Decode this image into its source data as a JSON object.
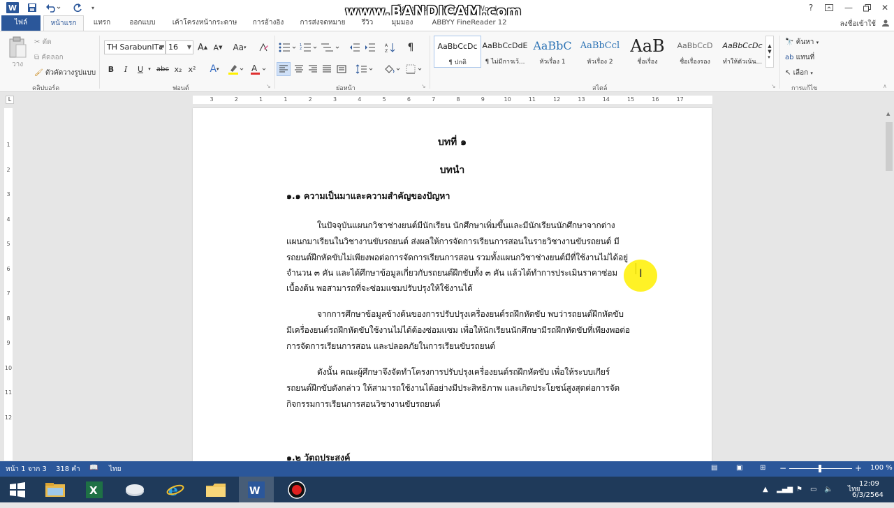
{
  "titlebar": {
    "title": "โครงการ1 - Microsoft Word",
    "watermark": "www.BANDICAM.com",
    "help": "?",
    "icons": [
      "save-icon",
      "undo-icon",
      "redo-icon",
      "customize-icon"
    ]
  },
  "tabs": [
    {
      "label": "ไฟล์"
    },
    {
      "label": "หน้าแรก"
    },
    {
      "label": "แทรก"
    },
    {
      "label": "ออกแบบ"
    },
    {
      "label": "เค้าโครงหน้ากระดาษ"
    },
    {
      "label": "การอ้างอิง"
    },
    {
      "label": "การส่งจดหมาย"
    },
    {
      "label": "รีวิว"
    },
    {
      "label": "มุมมอง"
    },
    {
      "label": "ABBYY FineReader 12"
    }
  ],
  "signin": "ลงชื่อเข้าใช้",
  "ribbon": {
    "clipboard": {
      "paste": "วาง",
      "cut": "ตัด",
      "copy": "คัดลอก",
      "format_painter": "ตัวคัดวางรูปแบบ",
      "label": "คลิปบอร์ด"
    },
    "font": {
      "name": "TH SarabunIT๙",
      "size": "16",
      "label": "ฟอนต์",
      "bold": "B",
      "italic": "I",
      "underline": "U",
      "strike": "abc",
      "sub": "x₂",
      "sup": "x²",
      "case": "Aa"
    },
    "paragraph": {
      "label": "ย่อหน้า"
    },
    "styles": {
      "label": "สไตล์",
      "items": [
        {
          "preview": "AaBbCcDc",
          "name": "¶ ปกติ"
        },
        {
          "preview": "AaBbCcDdE",
          "name": "¶ ไม่มีการเว้..."
        },
        {
          "preview": "AaBbC",
          "name": "หัวเรื่อง 1"
        },
        {
          "preview": "AaBbCcl",
          "name": "หัวเรื่อง 2"
        },
        {
          "preview": "AaB",
          "name": "ชื่อเรื่อง"
        },
        {
          "preview": "AaBbCcD",
          "name": "ชื่อเรื่องรอง"
        },
        {
          "preview": "AaBbCcDc",
          "name": "ทำให้ตัวเน้น..."
        }
      ]
    },
    "editing": {
      "label": "การแก้ไข",
      "find": "ค้นหา",
      "replace": "แทนที่",
      "select": "เลือก"
    }
  },
  "ruler": {
    "numbers": [
      "3",
      "2",
      "1",
      "1",
      "2",
      "3",
      "4",
      "5",
      "6",
      "7",
      "8",
      "9",
      "10",
      "11",
      "12",
      "13",
      "14",
      "15",
      "16",
      "17"
    ],
    "vnumbers": [
      "1",
      "2",
      "3",
      "4",
      "5",
      "6",
      "7",
      "8",
      "9",
      "10",
      "11",
      "12"
    ]
  },
  "document": {
    "chapter": "บทที่ ๑",
    "chapter_title": "บทนำ",
    "section1": "๑.๑ ความเป็นมาและความสำคัญของปัญหา",
    "para1": [
      "ในปัจจุบันแผนกวิชาช่างยนต์มีนักเรียน นักศึกษาเพิ่มขึ้นและมีนักเรียนนักศึกษาจากต่าง",
      "แผนกมาเรียนในวิชางานขับรถยนต์ ส่งผลให้การจัดการเรียนการสอนในรายวิชางานขับรถยนต์ มี",
      "รถยนต์ฝึกหัดขับไม่เพียงพอต่อการจัดการเรียนการสอน รวมทั้งแผนกวิชาช่างยนต์มีที่ใช้งานไม่ได้อยู่",
      "จำนวน ๓ คัน และได้ศึกษาข้อมูลเกี่ยวกับรถยนต์ฝึกขับทั้ง ๓ คัน แล้วได้ทำการประเมินราคาซ่อม",
      "เบื้องต้น พอสามารถที่จะซ่อมแซมปรับปรุงให้ใช้งานได้"
    ],
    "para2": [
      "จากการศึกษาข้อมูลข้างต้นของการปรับปรุงเครื่องยนต์รถฝึกหัดขับ พบว่ารถยนต์ฝึกหัดขับ",
      "มีเครื่องยนต์รถฝึกหัดขับใช้งานไม่ได้ต้องซ่อมแซม เพื่อให้นักเรียนนักศึกษามีรถฝึกหัดขับที่เพียงพอต่อ",
      "การจัดการเรียนการสอน และปลอดภัยในการเรียนขับรถยนต์"
    ],
    "para3": [
      "ดังนั้น คณะผู้ศึกษาจึงจัดทำโครงการปรับปรุงเครื่องยนต์รถฝึกหัดขับ เพื่อให้ระบบเกียร์",
      "รถยนต์ฝึกขับดังกล่าว ให้สามารถใช้งานได้อย่างมีประสิทธิภาพ และเกิดประโยชน์สูงสุดต่อการจัด",
      "กิจกรรมการเรียนการสอนวิชางานขับรถยนต์"
    ],
    "section2": "๑.๒ วัตถุประสงค์"
  },
  "status": {
    "page": "หน้า 1 จาก 3",
    "words": "318 คำ",
    "language": "ไทย",
    "zoom": "100 %",
    "zoom_minus": "−",
    "zoom_plus": "+"
  },
  "taskbar": {
    "time": "12:09",
    "date": "6/3/2564",
    "lang": "ไทย",
    "apps": [
      "start-icon",
      "file-explorer-icon",
      "excel-icon",
      "network-icon",
      "internet-explorer-icon",
      "folder-icon",
      "word-icon",
      "record-icon"
    ]
  },
  "colors": {
    "accent": "#2b579a",
    "taskbar": "#1f3a5a",
    "highlight": "#fff000"
  }
}
